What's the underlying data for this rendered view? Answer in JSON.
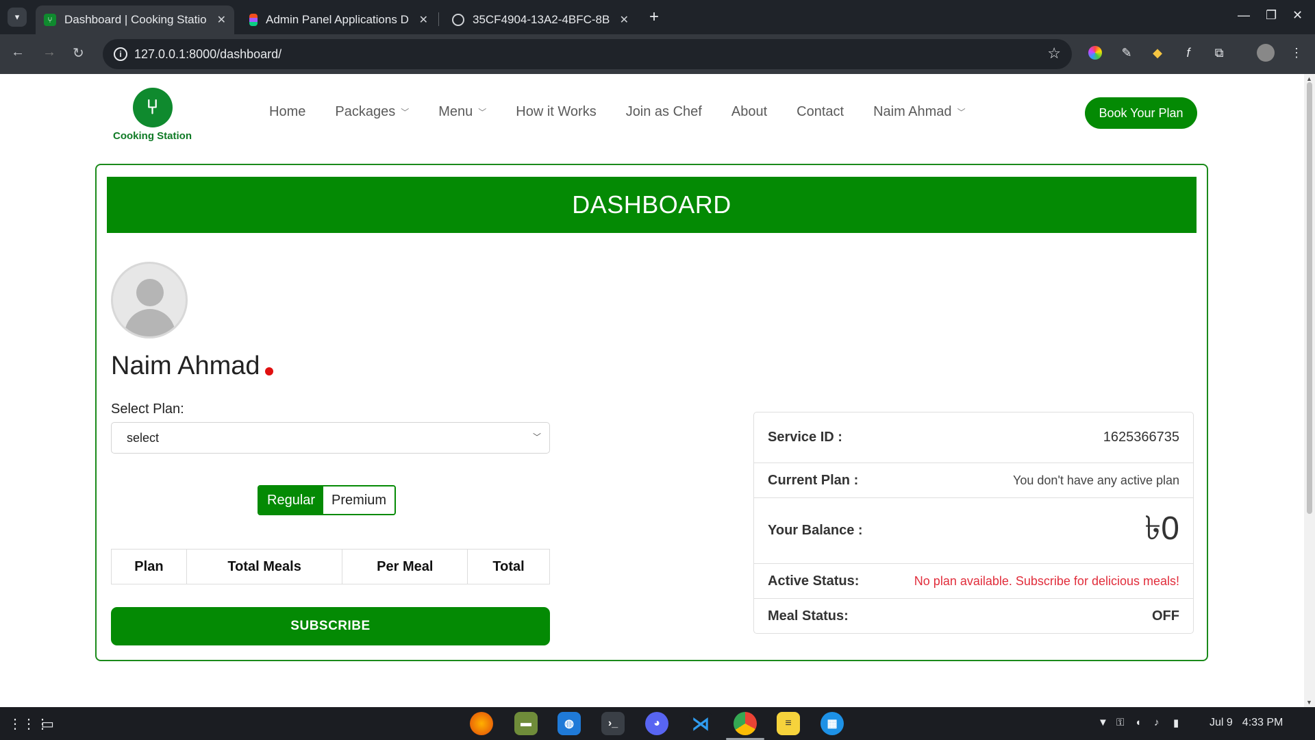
{
  "browser": {
    "tabs": [
      {
        "title": "Dashboard | Cooking Statio",
        "active": true,
        "favicon": "fork-knife-icon"
      },
      {
        "title": "Admin Panel Applications D",
        "active": false,
        "favicon": "figma-icon"
      },
      {
        "title": "35CF4904-13A2-4BFC-8B",
        "active": false,
        "favicon": "globe-icon"
      }
    ],
    "url": "127.0.0.1:8000/dashboard/"
  },
  "site": {
    "brand": "Cooking Station",
    "nav": [
      "Home",
      "Packages",
      "Menu",
      "How it Works",
      "Join as Chef",
      "About",
      "Contact",
      "Naim Ahmad"
    ],
    "cta": "Book Your Plan"
  },
  "dashboard": {
    "title": "DASHBOARD",
    "user_name": "Naim Ahmad",
    "select_label": "Select Plan:",
    "select_value": "select",
    "plan_types": [
      "Regular",
      "Premium"
    ],
    "table_headers": [
      "Plan",
      "Total Meals",
      "Per Meal",
      "Total"
    ],
    "subscribe": "SUBSCRIBE",
    "info": {
      "service_id_label": "Service ID :",
      "service_id": "1625366735",
      "current_plan_label": "Current Plan :",
      "current_plan": "You don't have any active plan",
      "balance_label": "Your Balance :",
      "balance": "৳0",
      "active_status_label": "Active Status:",
      "active_status": "No plan available. Subscribe for delicious meals!",
      "meal_status_label": "Meal Status:",
      "meal_status": "OFF"
    }
  },
  "taskbar": {
    "date": "Jul 9",
    "time": "4:33 PM"
  },
  "colors": {
    "brand_green": "#048a04",
    "alert_red": "#e12d3b",
    "chrome_dark": "#1f2329"
  }
}
